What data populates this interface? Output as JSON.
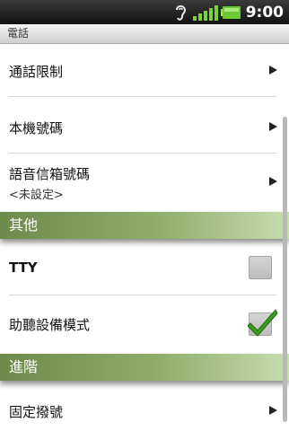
{
  "status_bar": {
    "time": "9:00",
    "icons": [
      "hearing-aid-icon",
      "signal-strength-icon",
      "battery-icon"
    ]
  },
  "header": {
    "title": "電話"
  },
  "items": {
    "call_barring": {
      "label": "通話限制"
    },
    "my_number": {
      "label": "本機號碼"
    },
    "voicemail_number": {
      "label": "語音信箱號碼",
      "summary": "<未設定>"
    },
    "tty": {
      "label": "TTY",
      "checked": false
    },
    "hearing_aid": {
      "label": "助聽設備模式",
      "checked": true
    },
    "fixed_dialing": {
      "label": "固定撥號"
    }
  },
  "sections": {
    "other": "其他",
    "advanced": "進階"
  },
  "colors": {
    "section_header": "#8fae6a",
    "checkmark": "#3c9a1e",
    "status_bar": "#1a1a1a"
  }
}
